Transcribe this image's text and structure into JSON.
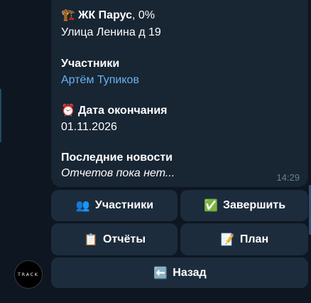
{
  "message": {
    "project": {
      "emoji": "🏗️",
      "name": "ЖК Парус",
      "progress": ", 0%",
      "address": "Улица Ленина д 19"
    },
    "participants": {
      "heading": "Участники",
      "name": "Артём Тупиков"
    },
    "deadline": {
      "emoji": "⏰",
      "heading": "Дата окончания",
      "date": "01.11.2026"
    },
    "news": {
      "heading": "Последние новости",
      "text": "Отчетов пока нет..."
    },
    "time": "14:29"
  },
  "keyboard": {
    "participants": {
      "emoji": "👥",
      "label": "Участники"
    },
    "finish": {
      "emoji": "✅",
      "label": "Завершить"
    },
    "reports": {
      "emoji": "📋",
      "label": "Отчёты"
    },
    "plan": {
      "emoji": "📝",
      "label": "План"
    },
    "back": {
      "emoji": "⬅️",
      "label": "Назад"
    }
  },
  "bot_avatar": {
    "text": "TRACK"
  },
  "colors": {
    "background": "#0e1621",
    "bubble": "#182533",
    "button": "#1c2c3c",
    "link": "#6ab2f2",
    "muted": "#6d7f8f"
  }
}
